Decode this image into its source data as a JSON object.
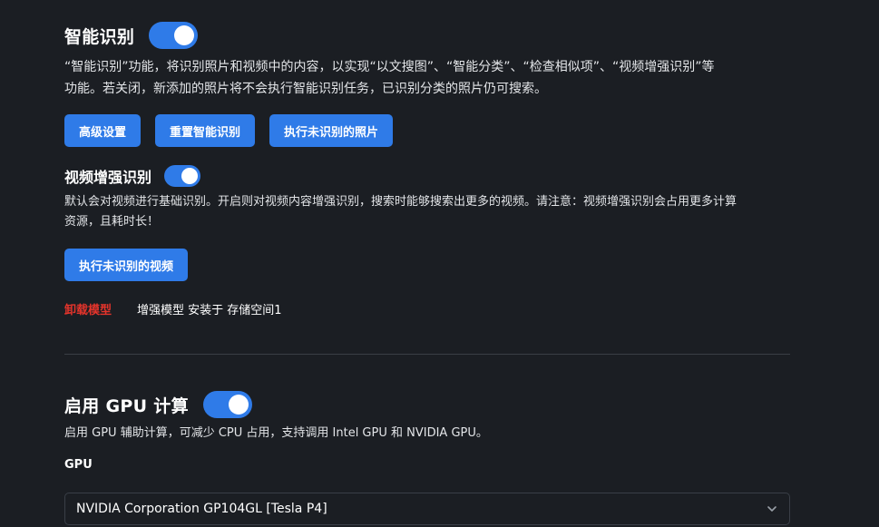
{
  "smart_recognition": {
    "title": "智能识别",
    "enabled": true,
    "description_line1": "“智能识别”功能，将识别照片和视频中的内容，以实现“以文搜图”、“智能分类”、“检查相似项”、“视频增强识别”等",
    "description_line2": "功能。若关闭，新添加的照片将不会执行智能识别任务，已识别分类的照片仍可搜索。",
    "buttons": {
      "advanced": "高级设置",
      "reset": "重置智能识别",
      "run_photos": "执行未识别的照片"
    }
  },
  "video_enhanced": {
    "title": "视频增强识别",
    "enabled": true,
    "description_line1": "默认会对视频进行基础识别。开启则对视频内容增强识别，搜索时能够搜索出更多的视频。请注意：视频增强识别会占用更多计算",
    "description_line2": "资源，且耗时长！",
    "run_videos_label": "执行未识别的视频",
    "uninstall_label": "卸载模型",
    "install_status": "增强模型 安装于 存储空间1"
  },
  "gpu": {
    "title": "启用 GPU 计算",
    "enabled": true,
    "description": "启用 GPU 辅助计算，可减少 CPU 占用，支持调用 Intel GPU 和 NVIDIA GPU。",
    "select_label": "GPU",
    "selected_value": "NVIDIA Corporation GP104GL [Tesla P4]"
  },
  "colors": {
    "background": "#1b1e23",
    "accent": "#2f7be8",
    "danger": "#e5342b"
  },
  "icons": {
    "select_chevron": "chevron-down-icon"
  }
}
